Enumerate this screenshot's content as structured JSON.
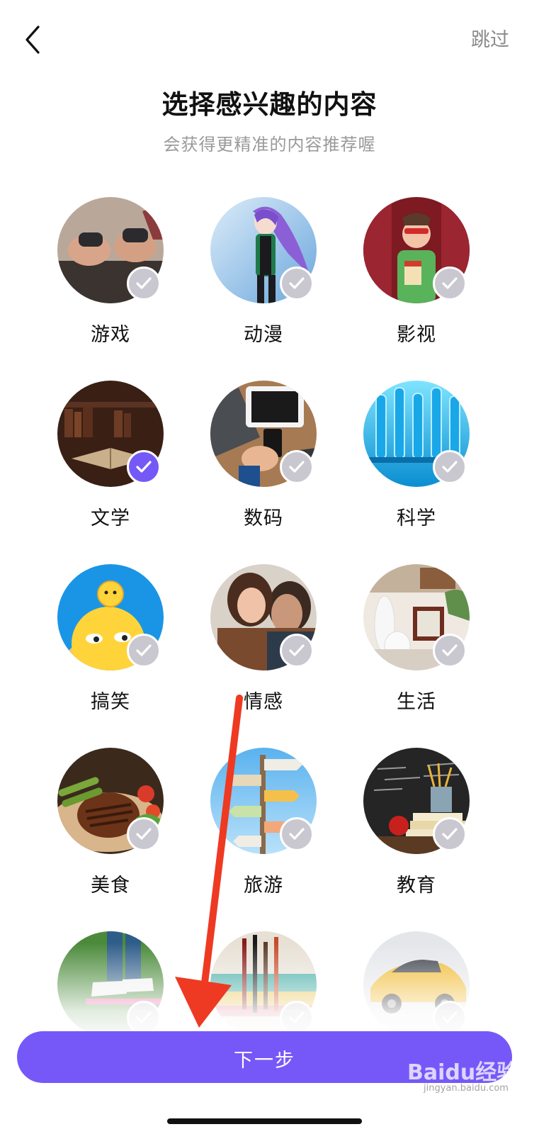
{
  "header": {
    "skip_label": "跳过",
    "title": "选择感兴趣的内容",
    "subtitle": "会获得更精准的内容推荐喔"
  },
  "categories": [
    {
      "label": "游戏",
      "selected": false,
      "icon": "gamepad-image"
    },
    {
      "label": "动漫",
      "selected": false,
      "icon": "anime-image"
    },
    {
      "label": "影视",
      "selected": false,
      "icon": "movie-image"
    },
    {
      "label": "文学",
      "selected": true,
      "icon": "books-image"
    },
    {
      "label": "数码",
      "selected": false,
      "icon": "digital-image"
    },
    {
      "label": "科学",
      "selected": false,
      "icon": "science-image"
    },
    {
      "label": "搞笑",
      "selected": false,
      "icon": "emoji-image"
    },
    {
      "label": "情感",
      "selected": false,
      "icon": "couple-image"
    },
    {
      "label": "生活",
      "selected": false,
      "icon": "home-decor-image"
    },
    {
      "label": "美食",
      "selected": false,
      "icon": "steak-image"
    },
    {
      "label": "旅游",
      "selected": false,
      "icon": "signpost-image"
    },
    {
      "label": "教育",
      "selected": false,
      "icon": "classroom-image"
    },
    {
      "label": "",
      "selected": false,
      "icon": "sneakers-image"
    },
    {
      "label": "",
      "selected": false,
      "icon": "paintbrush-image"
    },
    {
      "label": "",
      "selected": false,
      "icon": "sports-car-image"
    }
  ],
  "footer": {
    "next_label": "下一步"
  },
  "watermark": {
    "brand": "Baidu经验",
    "url": "jingyan.baidu.com"
  },
  "colors": {
    "accent": "#7658f8",
    "check_unselected": "#c9c8d0",
    "annotation_arrow": "#ee3a22"
  }
}
